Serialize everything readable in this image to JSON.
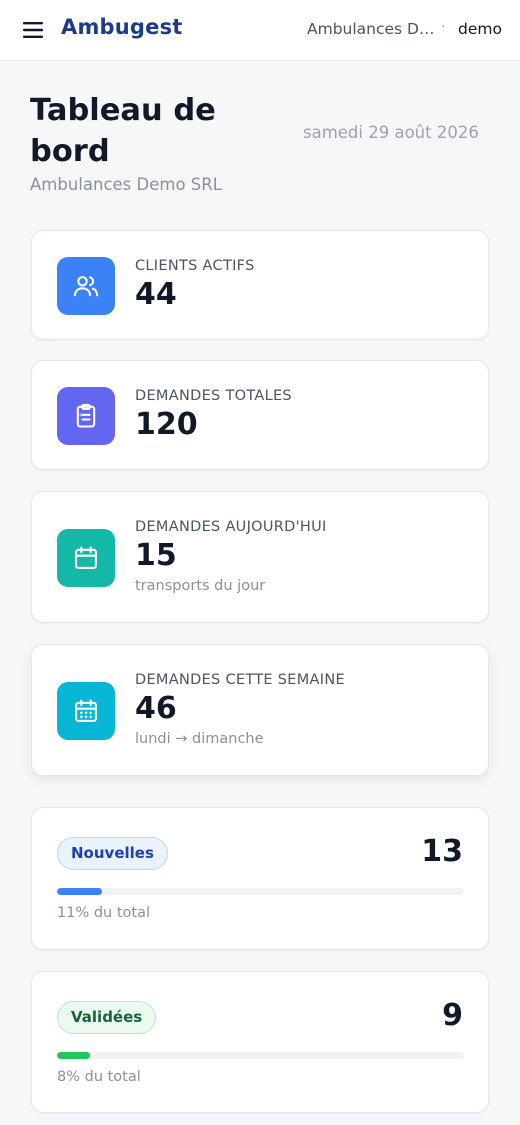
{
  "header": {
    "brand": "Ambugest",
    "tenant": "Ambulances Demo SRL",
    "separator": "·",
    "user": "demo",
    "menu_icon": "hamburger-menu-icon"
  },
  "page": {
    "title": "Tableau de bord",
    "subtitle": "Ambulances Demo SRL",
    "date": "samedi 29 août 2026"
  },
  "stats": [
    {
      "label": "CLIENTS ACTIFS",
      "value": "44",
      "hint": "",
      "icon": "users-icon",
      "color": "#3b82f6"
    },
    {
      "label": "DEMANDES TOTALES",
      "value": "120",
      "hint": "",
      "icon": "clipboard-list-icon",
      "color": "#6366f1"
    },
    {
      "label": "DEMANDES AUJOURD'HUI",
      "value": "15",
      "hint": "transports du jour",
      "icon": "calendar-icon",
      "color": "#14b8a6"
    },
    {
      "label": "DEMANDES CETTE SEMAINE",
      "value": "46",
      "hint": "lundi → dimanche",
      "icon": "calendar-days-icon",
      "color": "#06b6d4"
    }
  ],
  "statuses": [
    {
      "label": "Nouvelles",
      "count": "13",
      "pct_text": "11% du total",
      "fraction": 0.11,
      "color": "#3b82f6"
    },
    {
      "label": "Validées",
      "count": "9",
      "pct_text": "8% du total",
      "fraction": 0.08,
      "color": "#22c55e"
    }
  ]
}
